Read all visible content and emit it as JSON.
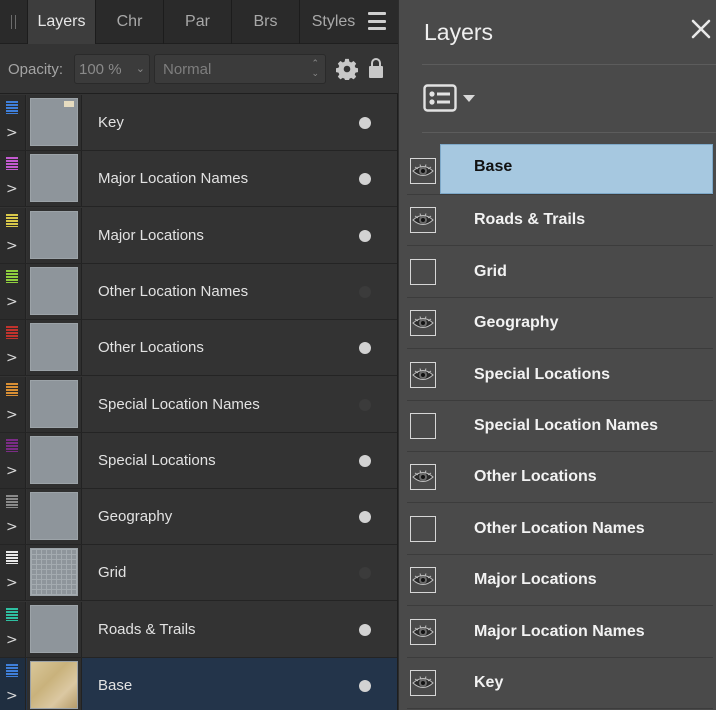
{
  "left_panel": {
    "tabs": [
      {
        "label": "Layers",
        "active": true
      },
      {
        "label": "Chr",
        "active": false
      },
      {
        "label": "Par",
        "active": false
      },
      {
        "label": "Brs",
        "active": false
      },
      {
        "label": "Styles",
        "active": false
      }
    ],
    "opacity_label": "Opacity:",
    "opacity_value": "100 %",
    "blend_mode": "Normal",
    "layers": [
      {
        "name": "Key",
        "color": "#3f7fd9",
        "visible": true,
        "thumb": "key",
        "selected": false
      },
      {
        "name": "Major Location Names",
        "color": "#c35ad0",
        "visible": true,
        "thumb": "plain",
        "selected": false
      },
      {
        "name": "Major Locations",
        "color": "#d8c84a",
        "visible": true,
        "thumb": "plain",
        "selected": false
      },
      {
        "name": "Other Location Names",
        "color": "#8fcf3e",
        "visible": false,
        "thumb": "plain",
        "selected": false
      },
      {
        "name": "Other Locations",
        "color": "#c0332d",
        "visible": true,
        "thumb": "plain",
        "selected": false
      },
      {
        "name": "Special Location Names",
        "color": "#d98f34",
        "visible": false,
        "thumb": "plain",
        "selected": false
      },
      {
        "name": "Special Locations",
        "color": "#7b2c86",
        "visible": true,
        "thumb": "plain",
        "selected": false
      },
      {
        "name": "Geography",
        "color": "#8a8a8a",
        "visible": true,
        "thumb": "plain",
        "selected": false
      },
      {
        "name": "Grid",
        "color": "#e8e8e8",
        "visible": false,
        "thumb": "grid",
        "selected": false
      },
      {
        "name": "Roads & Trails",
        "color": "#2fbfa1",
        "visible": true,
        "thumb": "plain",
        "selected": false
      },
      {
        "name": "Base",
        "color": "#3f7fd9",
        "visible": true,
        "thumb": "map",
        "selected": true
      }
    ]
  },
  "right_panel": {
    "title": "Layers",
    "layers": [
      {
        "name": "Base",
        "visible": true,
        "selected": true
      },
      {
        "name": "Roads & Trails",
        "visible": true,
        "selected": false
      },
      {
        "name": "Grid",
        "visible": false,
        "selected": false
      },
      {
        "name": "Geography",
        "visible": true,
        "selected": false
      },
      {
        "name": "Special Locations",
        "visible": true,
        "selected": false
      },
      {
        "name": "Special Location Names",
        "visible": false,
        "selected": false
      },
      {
        "name": "Other Locations",
        "visible": true,
        "selected": false
      },
      {
        "name": "Other Location Names",
        "visible": false,
        "selected": false
      },
      {
        "name": "Major Locations",
        "visible": true,
        "selected": false
      },
      {
        "name": "Major Location Names",
        "visible": true,
        "selected": false
      },
      {
        "name": "Key",
        "visible": true,
        "selected": false
      }
    ]
  }
}
